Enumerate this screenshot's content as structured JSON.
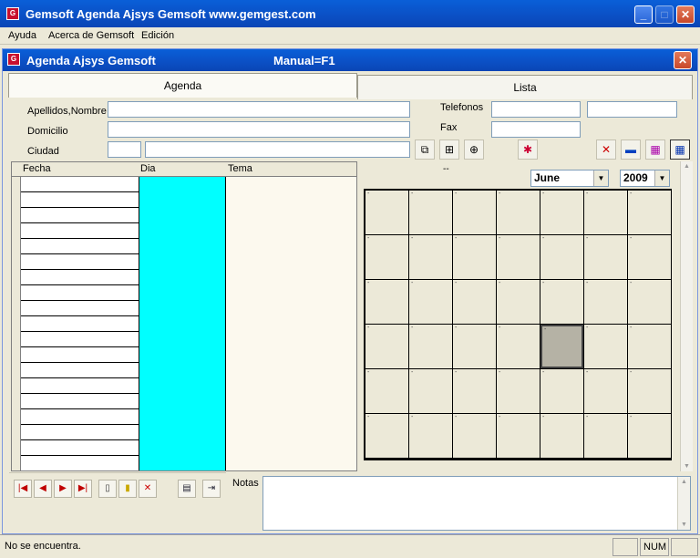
{
  "window": {
    "title": "Gemsoft Agenda Ajsys Gemsoft www.gemgest.com",
    "icon_letter": "G"
  },
  "menu": {
    "items": [
      "Ayuda",
      "Acerca de Gemsoft",
      "Edición"
    ]
  },
  "inner_window": {
    "title": "Agenda Ajsys Gemsoft",
    "hint": "Manual=F1"
  },
  "tabs": [
    "Agenda",
    "Lista"
  ],
  "form": {
    "apellidos_label": "Apellidos,Nombre",
    "domicilio_label": "Domicilio",
    "ciudad_label": "Ciudad",
    "telefonos_label": "Telefonos",
    "fax_label": "Fax"
  },
  "grid": {
    "columns": [
      "Fecha",
      "Dia",
      "Tema"
    ],
    "row_count": 19
  },
  "calendar": {
    "month": "June",
    "year": "2009",
    "header_text": "--",
    "weeks": 6,
    "days_per_week": 7,
    "selected_week": 3,
    "selected_day": 4
  },
  "notes": {
    "label": "Notas"
  },
  "status": {
    "message": "No se encuentra.",
    "num": "NUM"
  },
  "icons": {
    "first": "first-record-icon",
    "prev": "prev-record-icon",
    "next": "next-record-icon",
    "last": "last-record-icon"
  }
}
